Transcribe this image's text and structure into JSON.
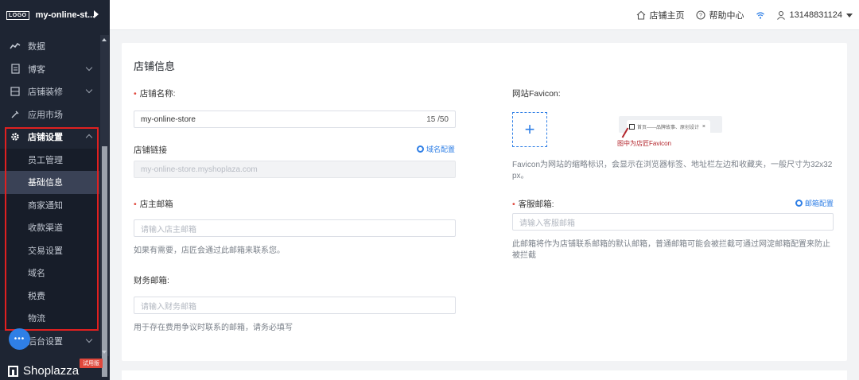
{
  "sidebar": {
    "logo": "LOGO",
    "store_name": "my-online-st...",
    "menu": [
      {
        "label": "数据",
        "icon": "trend-icon"
      },
      {
        "label": "博客",
        "icon": "blog-icon"
      },
      {
        "label": "店铺装修",
        "icon": "layout-icon"
      },
      {
        "label": "应用市场",
        "icon": "puzzle-icon"
      },
      {
        "label": "店铺设置",
        "icon": "gear-icon"
      }
    ],
    "sub_items": [
      "员工管理",
      "基础信息",
      "商家通知",
      "收款渠道",
      "交易设置",
      "域名",
      "税费",
      "物流"
    ],
    "bottom_item": "后台设置",
    "trial_badge": "试用版",
    "brand": "Shoplazza"
  },
  "topbar": {
    "store_home": "店铺主页",
    "help_center": "帮助中心",
    "account": "13148831124"
  },
  "main": {
    "title": "店铺信息",
    "store_name_label": "店铺名称:",
    "store_name_value": "my-online-store",
    "store_name_count": "15 /50",
    "store_link_label": "店铺链接",
    "domain_config": "域名配置",
    "store_link_value": "my-online-store.myshoplaza.com",
    "owner_email_label": "店主邮箱",
    "owner_email_placeholder": "请输入店主邮箱",
    "owner_email_hint": "如果有需要，店匠会通过此邮箱来联系您。",
    "finance_email_label": "财务邮箱:",
    "finance_email_placeholder": "请输入财务邮箱",
    "finance_email_hint": "用于存在费用争议时联系的邮箱，请务必填写",
    "favicon_label": "网站Favicon:",
    "favicon_preview_text": "首页——品牌故事、原创设计",
    "favicon_preview_close": "×",
    "favicon_caption": "图中为店匠Favicon",
    "favicon_hint": "Favicon为网站的缩略标识，会显示在浏览器标签、地址栏左边和收藏夹，一般尺寸为32x32 px。",
    "service_email_label": "客服邮箱:",
    "email_config": "邮箱配置",
    "service_email_placeholder": "请输入客服邮箱",
    "service_email_hint": "此邮箱将作为店铺联系邮箱的默认邮箱，普通邮箱可能会被拦截可通过网淀邮箱配置来防止被拦截"
  },
  "colors": {
    "sidebar_bg": "#1e2533",
    "accent": "#2f7fe6",
    "highlight": "#e02020"
  }
}
